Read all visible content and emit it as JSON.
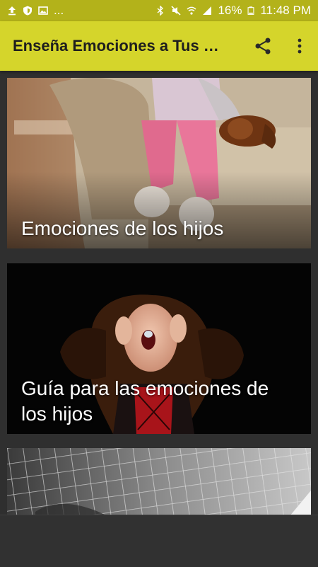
{
  "status_bar": {
    "left_icons": [
      "upload-icon",
      "shield-icon",
      "image-icon"
    ],
    "overflow_dots": "...",
    "right_icons": [
      "bluetooth-icon",
      "mute-icon",
      "wifi-icon",
      "signal-icon",
      "battery-icon"
    ],
    "battery_percent": "16%",
    "time": "11:48 PM"
  },
  "app_bar": {
    "title": "Enseña Emociones a Tus Hijos",
    "actions": [
      "share-icon",
      "more-vert-icon"
    ],
    "background": "#d5d52b"
  },
  "cards": [
    {
      "title": "Emociones de los hijos"
    },
    {
      "title": "Guía para las emociones de los hijos"
    },
    {
      "title": ""
    }
  ],
  "colors": {
    "status_bar": "#b3b21a",
    "app_bar": "#d5d52b",
    "background": "#2f2f2f"
  }
}
